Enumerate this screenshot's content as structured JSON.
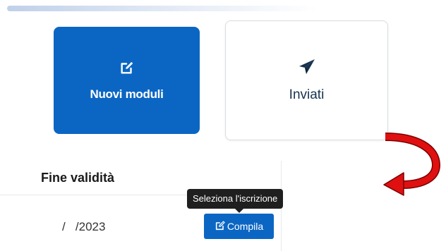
{
  "tiles": {
    "new_modules": {
      "label": "Nuovi moduli",
      "icon": "edit-icon"
    },
    "sent": {
      "label": "Inviati",
      "icon": "paper-plane-icon"
    }
  },
  "table": {
    "header": "Fine validità",
    "rows": [
      {
        "end_date": "/   /2023",
        "action_label": "Compila",
        "action_icon": "edit-icon"
      }
    ]
  },
  "tooltip": {
    "text": "Seleziona l'iscrizione"
  },
  "colors": {
    "primary": "#0b66c3",
    "annotation_arrow": "#e01010"
  }
}
